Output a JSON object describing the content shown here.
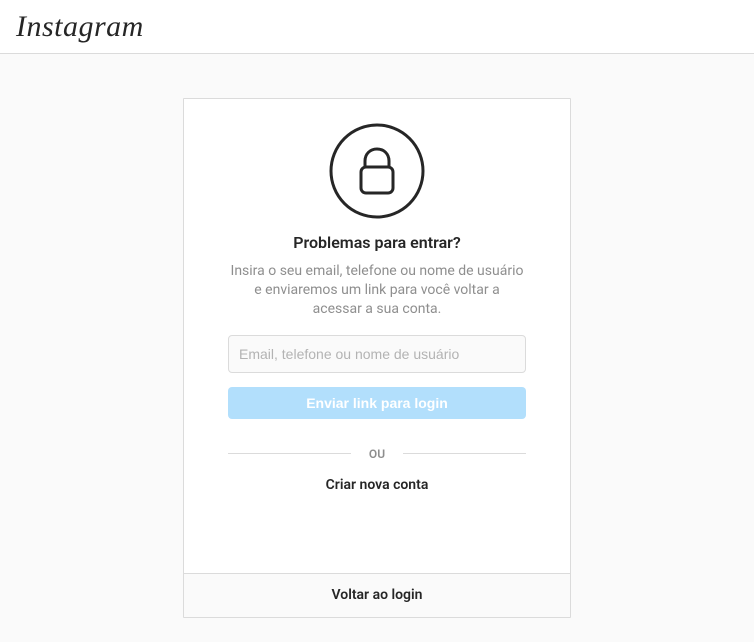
{
  "header": {
    "logo_text": "Instagram"
  },
  "card": {
    "heading": "Problemas para entrar?",
    "subtext": "Insira o seu email, telefone ou nome de usuário e enviaremos um link para você voltar a acessar a sua conta.",
    "input_placeholder": "Email, telefone ou nome de usuário",
    "input_value": "",
    "submit_label": "Enviar link para login",
    "divider_label": "OU",
    "create_account_label": "Criar nova conta",
    "back_label": "Voltar ao login"
  },
  "colors": {
    "accent_disabled": "#b2dffc",
    "border": "#dbdbdb",
    "muted": "#8e8e8e"
  }
}
